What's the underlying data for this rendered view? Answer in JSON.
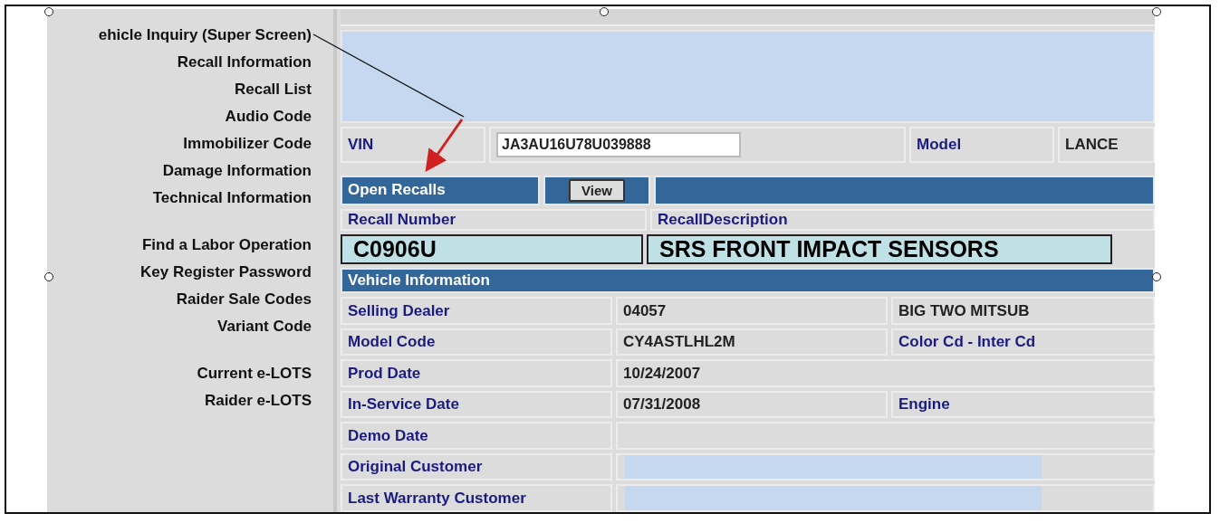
{
  "nav_groups": [
    [
      "ehicle Inquiry (Super Screen)",
      "Recall Information",
      "Recall List",
      "Audio Code",
      "Immobilizer Code",
      "Damage Information",
      "Technical Information"
    ],
    [
      "Find a Labor Operation",
      "Key Register Password",
      "Raider Sale Codes",
      "Variant Code"
    ],
    [
      "Current e-LOTS",
      "Raider e-LOTS"
    ]
  ],
  "vin": {
    "label": "VIN",
    "value": "JA3AU16U78U039888",
    "model_label": "Model",
    "model_value": "LANCE"
  },
  "open_recalls": {
    "title": "Open Recalls",
    "button": "View"
  },
  "recall_columns": [
    "Recall Number",
    "RecallDescription"
  ],
  "recall": {
    "number": "C0906U",
    "description": "SRS FRONT IMPACT SENSORS"
  },
  "vehicle_info": {
    "title": "Vehicle Information",
    "rows": [
      {
        "kind": "split",
        "label": "Selling Dealer",
        "value": "04057",
        "third": {
          "kind": "value",
          "text": "BIG TWO MITSUB"
        }
      },
      {
        "kind": "split",
        "label": "Model Code",
        "value": "CY4ASTLHL2M",
        "third": {
          "kind": "label",
          "text": "Color Cd - Inter Cd"
        }
      },
      {
        "kind": "wide",
        "label": "Prod Date",
        "value": "10/24/2007"
      },
      {
        "kind": "split",
        "label": "In-Service Date",
        "value": "07/31/2008",
        "third": {
          "kind": "label",
          "text": "Engine"
        }
      },
      {
        "kind": "wide",
        "label": "Demo Date"
      },
      {
        "kind": "masked",
        "label": "Original Customer"
      },
      {
        "kind": "masked",
        "label": "Last Warranty Customer"
      }
    ]
  }
}
